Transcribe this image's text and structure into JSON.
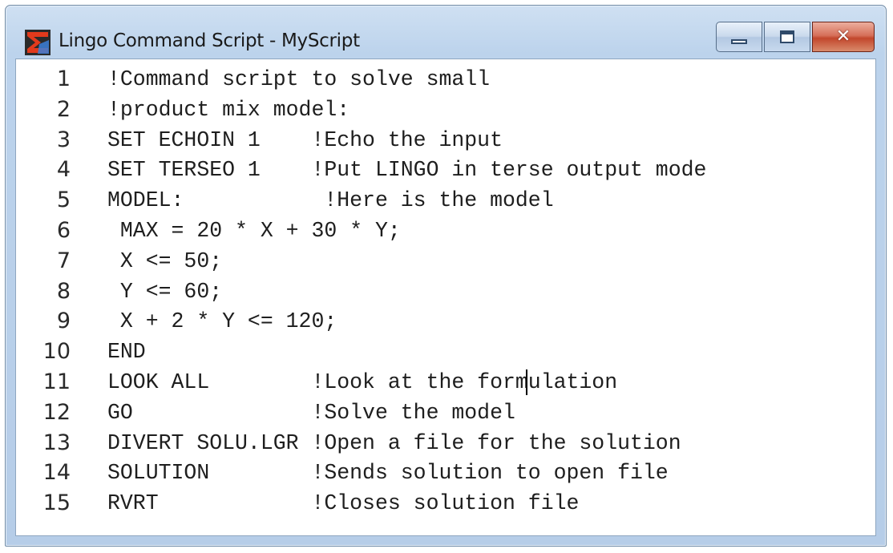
{
  "window": {
    "title": "Lingo Command Script - MyScript",
    "app_icon": "lingo-sigma-icon",
    "buttons": {
      "minimize_icon": "minimize-icon",
      "maximize_icon": "maximize-icon",
      "close_icon": "close-icon",
      "close_glyph": "✕"
    }
  },
  "editor": {
    "lines": [
      {
        "number": "1",
        "text": "!Command script to solve small"
      },
      {
        "number": "2",
        "text": "!product mix model:"
      },
      {
        "number": "3",
        "text": "SET ECHOIN 1    !Echo the input"
      },
      {
        "number": "4",
        "text": "SET TERSEO 1    !Put LINGO in terse output mode"
      },
      {
        "number": "5",
        "text": "MODEL:           !Here is the model"
      },
      {
        "number": "6",
        "text": " MAX = 20 * X + 30 * Y;"
      },
      {
        "number": "7",
        "text": " X <= 50;"
      },
      {
        "number": "8",
        "text": " Y <= 60;"
      },
      {
        "number": "9",
        "text": " X + 2 * Y <= 120;"
      },
      {
        "number": "10",
        "text": "END"
      },
      {
        "number": "11",
        "text": "LOOK ALL        !Look at the formulation"
      },
      {
        "number": "12",
        "text": "GO              !Solve the model"
      },
      {
        "number": "13",
        "text": "DIVERT SOLU.LGR !Open a file for the solution"
      },
      {
        "number": "14",
        "text": "SOLUTION        !Sends solution to open file"
      },
      {
        "number": "15",
        "text": "RVRT            !Closes solution file"
      }
    ]
  }
}
